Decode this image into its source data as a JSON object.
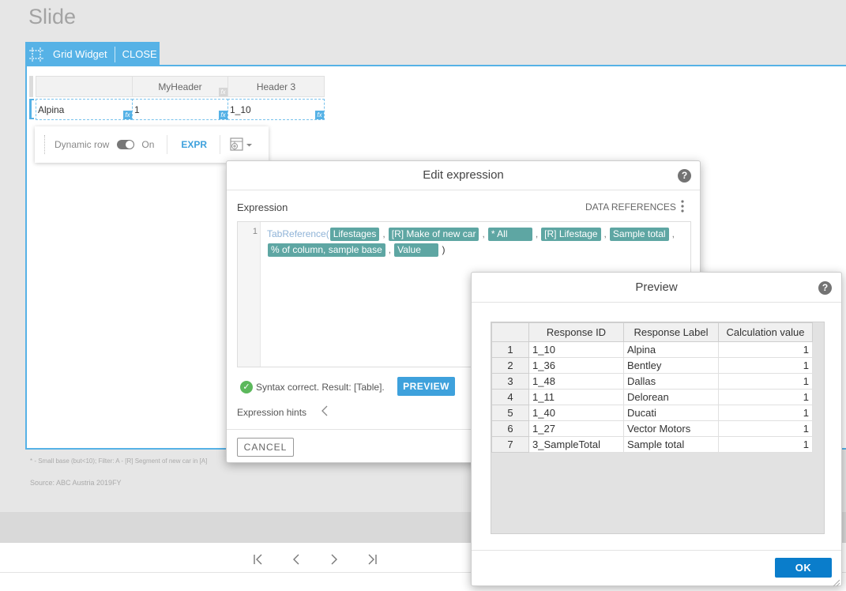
{
  "slide": {
    "title": "Slide"
  },
  "widget_toolbar": {
    "label": "Grid Widget",
    "close_label": "CLOSE"
  },
  "grid": {
    "headers": [
      "",
      "MyHeader",
      "Header 3"
    ],
    "row": [
      "Alpina",
      "1",
      "1_10"
    ]
  },
  "row_menu": {
    "dynamic_label": "Dynamic row",
    "toggle_state": "On",
    "expr_label": "EXPR"
  },
  "footnotes": {
    "line1": "* - Small base (but<10);   Filter: A - [R] Segment of new car in [A]",
    "line2": "Source: ABC Austria 2019FY"
  },
  "edit_dialog": {
    "title": "Edit expression",
    "expression_label": "Expression",
    "data_refs_label": "DATA REFERENCES",
    "line_number": "1",
    "function_name": "TabReference(",
    "chips": [
      "Lifestages",
      "[R] Make of new car",
      "* All",
      "[R] Lifestage",
      "Sample total",
      "% of column, sample base",
      "Value"
    ],
    "close_paren": ")",
    "syntax_text": "Syntax correct. Result: [Table].",
    "preview_label": "PREVIEW",
    "hints_label": "Expression hints",
    "cancel_label": "CANCEL"
  },
  "preview_dialog": {
    "title": "Preview",
    "columns": [
      "Response ID",
      "Response Label",
      "Calculation value"
    ],
    "rows": [
      {
        "n": "1",
        "id": "1_10",
        "label": "Alpina",
        "value": "1"
      },
      {
        "n": "2",
        "id": "1_36",
        "label": "Bentley",
        "value": "1"
      },
      {
        "n": "3",
        "id": "1_48",
        "label": "Dallas",
        "value": "1"
      },
      {
        "n": "4",
        "id": "1_11",
        "label": "Delorean",
        "value": "1"
      },
      {
        "n": "5",
        "id": "1_40",
        "label": "Ducati",
        "value": "1"
      },
      {
        "n": "6",
        "id": "1_27",
        "label": "Vector Motors",
        "value": "1"
      },
      {
        "n": "7",
        "id": "3_SampleTotal",
        "label": "Sample total",
        "value": "1"
      }
    ],
    "ok_label": "OK"
  },
  "icons": {
    "help": "?",
    "check": "✓",
    "fx": "fx"
  },
  "colors": {
    "accent": "#56b2e6",
    "chip": "#5ea6a3",
    "ok_button": "#0a7dcb",
    "preview_button": "#3ea1dc"
  }
}
